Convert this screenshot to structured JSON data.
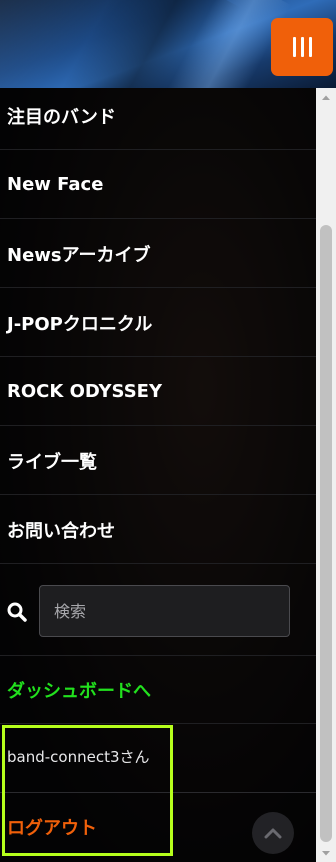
{
  "menu": {
    "items": [
      {
        "label": "注目のバンド"
      },
      {
        "label": "New Face"
      },
      {
        "label": "Newsアーカイブ"
      },
      {
        "label": "J-POPクロニクル"
      },
      {
        "label": "ROCK ODYSSEY"
      },
      {
        "label": "ライブ一覧"
      },
      {
        "label": "お問い合わせ"
      }
    ]
  },
  "search": {
    "placeholder": "検索"
  },
  "dashboard_label": "ダッシュボードへ",
  "user": {
    "name": "band-connect3さん",
    "logout_label": "ログアウト"
  },
  "colors": {
    "accent": "#f0600a",
    "dashboard_link": "#22e01e",
    "highlight": "#b6ff1c"
  },
  "icons": {
    "menu_toggle": "hamburger-icon",
    "search": "search-icon",
    "back_to_top": "chevron-up-icon"
  }
}
